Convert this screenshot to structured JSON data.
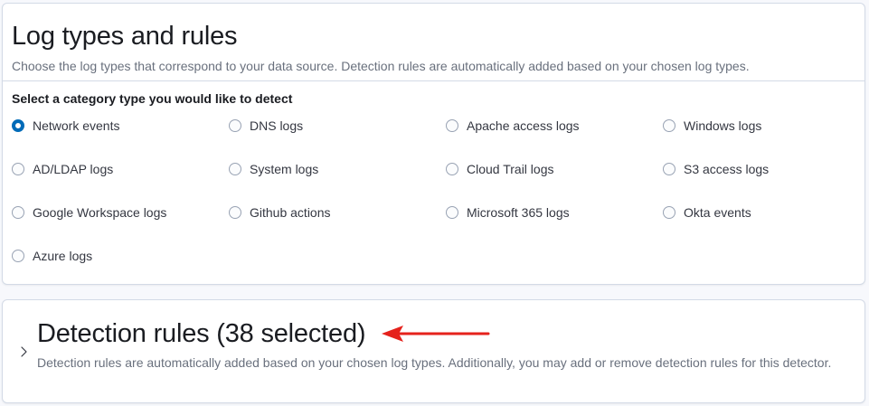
{
  "log_types": {
    "title": "Log types and rules",
    "description": "Choose the log types that correspond to your data source. Detection rules are automatically added based on your chosen log types.",
    "category_label": "Select a category type you would like to detect",
    "options": [
      {
        "label": "Network events",
        "checked": true
      },
      {
        "label": "DNS logs",
        "checked": false
      },
      {
        "label": "Apache access logs",
        "checked": false
      },
      {
        "label": "Windows logs",
        "checked": false
      },
      {
        "label": "AD/LDAP logs",
        "checked": false
      },
      {
        "label": "System logs",
        "checked": false
      },
      {
        "label": "Cloud Trail logs",
        "checked": false
      },
      {
        "label": "S3 access logs",
        "checked": false
      },
      {
        "label": "Google Workspace logs",
        "checked": false
      },
      {
        "label": "Github actions",
        "checked": false
      },
      {
        "label": "Microsoft 365 logs",
        "checked": false
      },
      {
        "label": "Okta events",
        "checked": false
      },
      {
        "label": "Azure logs",
        "checked": false
      }
    ]
  },
  "detection_rules": {
    "title": "Detection rules (38 selected)",
    "description": "Detection rules are automatically added based on your chosen log types. Additionally, you may add or remove detection rules for this detector.",
    "expanded": false
  },
  "icons": {
    "chevron": "chevron-right-icon",
    "annotation_arrow": "arrow-left-icon"
  },
  "colors": {
    "accent": "#006bb8",
    "annotation_arrow": "#e5221c",
    "border": "#d3dae6",
    "muted_text": "#69707d"
  }
}
